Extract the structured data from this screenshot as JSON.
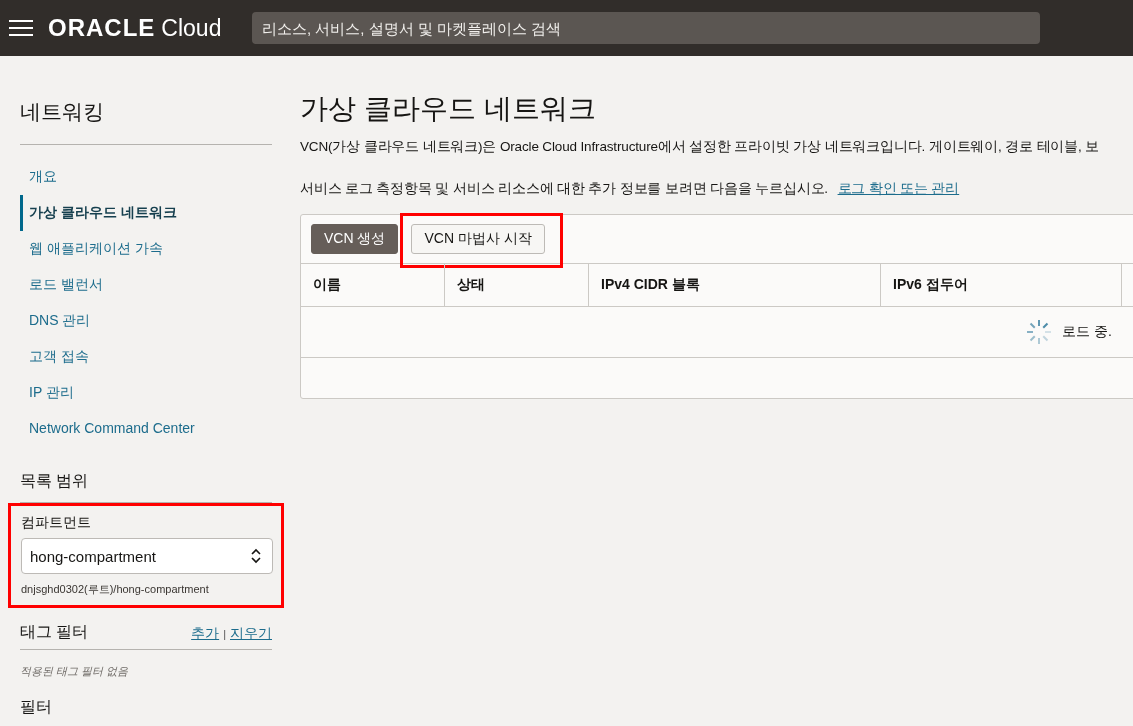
{
  "header": {
    "brand": "ORACLE",
    "brand_suffix": "Cloud",
    "search": {
      "placeholder": "리소스, 서비스, 설명서 및 마켓플레이스 검색"
    }
  },
  "sidebar": {
    "title": "네트워킹",
    "items": [
      {
        "label": "개요",
        "selected": false
      },
      {
        "label": "가상 클라우드 네트워크",
        "selected": true
      },
      {
        "label": "웹 애플리케이션 가속",
        "selected": false
      },
      {
        "label": "로드 밸런서",
        "selected": false
      },
      {
        "label": "DNS 관리",
        "selected": false
      },
      {
        "label": "고객 접속",
        "selected": false
      },
      {
        "label": "IP 관리",
        "selected": false
      },
      {
        "label": "Network Command Center",
        "selected": false
      }
    ],
    "scope": {
      "title": "목록 범위",
      "label": "컴파트먼트",
      "value": "hong-compartment",
      "path": "dnjsghd0302(루트)/hong-compartment",
      "highlighted": true
    },
    "tag_filters": {
      "title": "태그 필터",
      "add": "추가",
      "separator": "|",
      "clear": "지우기",
      "empty": "적용된 태그 필터 없음"
    },
    "filters": {
      "title": "필터"
    }
  },
  "main": {
    "title": "가상 클라우드 네트워크",
    "description": "VCN(가상 클라우드 네트워크)은 Oracle Cloud Infrastructure에서 설정한 프라이빗 가상 네트워크입니다. 게이트웨이, 경로 테이블, 보",
    "log_note": "서비스 로그 측정항목 및 서비스 리소스에 대한 추가 정보를 보려면 다음을 누르십시오.",
    "log_link": "로그 확인 또는 관리",
    "buttons": [
      {
        "label": "VCN 생성",
        "kind": "primary",
        "highlighted": false
      },
      {
        "label": "VCN 마법사 시작",
        "kind": "secondary",
        "highlighted": true
      }
    ],
    "table": {
      "columns": [
        "이름",
        "상태",
        "IPv4 CIDR 블록",
        "IPv6 접두어"
      ],
      "loading": "로드 중."
    }
  }
}
